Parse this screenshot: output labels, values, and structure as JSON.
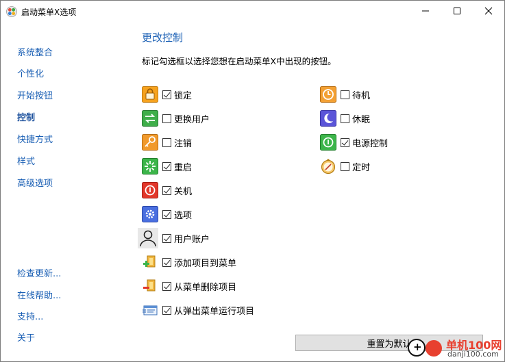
{
  "window": {
    "title": "启动菜单X选项"
  },
  "sidebar": {
    "items": [
      "系统整合",
      "个性化",
      "开始按钮",
      "控制",
      "快捷方式",
      "样式",
      "高级选项"
    ],
    "active_index": 3,
    "links": [
      "检查更新...",
      "在线帮助...",
      "支持...",
      "关于"
    ]
  },
  "main": {
    "heading": "更改控制",
    "description": "标记勾选框以选择您想在启动菜单X中出现的按钮。",
    "left_options": [
      {
        "label": "锁定",
        "checked": true,
        "icon": "lock-icon"
      },
      {
        "label": "更换用户",
        "checked": false,
        "icon": "switch-user-icon"
      },
      {
        "label": "注销",
        "checked": false,
        "icon": "key-icon"
      },
      {
        "label": "重启",
        "checked": true,
        "icon": "restart-icon"
      },
      {
        "label": "关机",
        "checked": true,
        "icon": "shutdown-icon"
      },
      {
        "label": "选项",
        "checked": true,
        "icon": "gear-icon"
      },
      {
        "label": "用户账户",
        "checked": true,
        "icon": "user-icon"
      },
      {
        "label": "添加项目到菜单",
        "checked": true,
        "icon": "add-item-icon"
      },
      {
        "label": "从菜单删除项目",
        "checked": true,
        "icon": "remove-item-icon"
      },
      {
        "label": "从弹出菜单运行项目",
        "checked": true,
        "icon": "run-icon"
      }
    ],
    "right_options": [
      {
        "label": "待机",
        "checked": false,
        "icon": "standby-icon"
      },
      {
        "label": "休眠",
        "checked": false,
        "icon": "hibernate-icon"
      },
      {
        "label": "电源控制",
        "checked": true,
        "icon": "power-control-icon"
      },
      {
        "label": "定时",
        "checked": false,
        "icon": "timer-icon"
      }
    ],
    "reset_label": "重置为默认"
  },
  "watermark": {
    "text": "单机100网",
    "sub": "danji100.com"
  }
}
